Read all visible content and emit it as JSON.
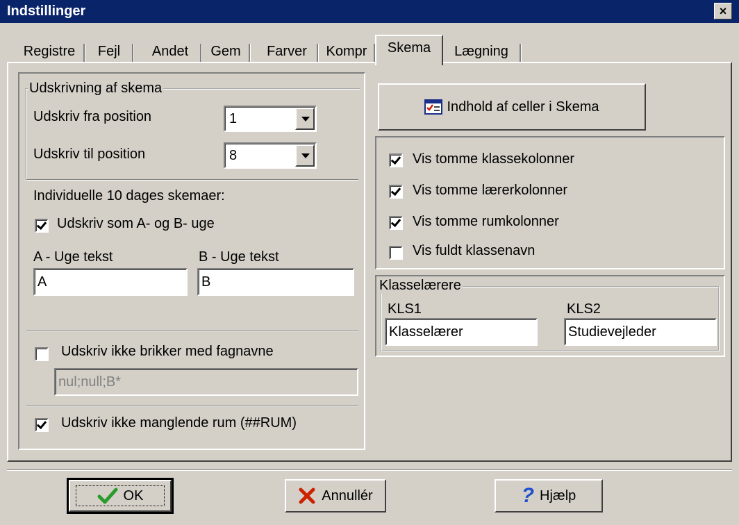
{
  "window": {
    "title": "Indstillinger",
    "close_label": "×"
  },
  "tabs": [
    {
      "label": "Registre"
    },
    {
      "label": "Fejl"
    },
    {
      "label": "Andet"
    },
    {
      "label": "Gem"
    },
    {
      "label": "Farver"
    },
    {
      "label": "Kompr"
    },
    {
      "label": "Skema",
      "active": true
    },
    {
      "label": "Lægning"
    }
  ],
  "print_group": {
    "label": "Udskrivning af skema",
    "from_label": "Udskriv fra position",
    "from_value": "1",
    "to_label": "Udskriv til position",
    "to_value": "8"
  },
  "ten_day": {
    "heading": "Individuelle 10 dages skemaer:",
    "ab_week_label": "Udskriv som A- og B- uge",
    "ab_week_checked": true,
    "a_label": "A - Uge tekst",
    "a_value": "A",
    "b_label": "B - Uge tekst",
    "b_value": "B"
  },
  "subjects": {
    "label": "Udskriv ikke brikker med fagnavne",
    "checked": false,
    "value": "nul;null;B*"
  },
  "missing_room": {
    "label": "Udskriv ikke manglende rum (##RUM)",
    "checked": true
  },
  "cells_button": {
    "label": "Indhold af celler i Skema"
  },
  "show_options": [
    {
      "label": "Vis tomme klassekolonner",
      "checked": true
    },
    {
      "label": "Vis tomme lærerkolonner",
      "checked": true
    },
    {
      "label": "Vis tomme rumkolonner",
      "checked": true
    },
    {
      "label": "Vis fuldt klassenavn",
      "checked": false
    }
  ],
  "class_teachers": {
    "label": "Klasselærere",
    "kls1_label": "KLS1",
    "kls1_value": "Klasselærer",
    "kls2_label": "KLS2",
    "kls2_value": "Studievejleder"
  },
  "buttons": {
    "ok": "OK",
    "cancel": "Annullér",
    "help": "Hjælp"
  },
  "colors": {
    "face": "#d4d0c8",
    "title": "#0a246a",
    "check_red": "#cc2200",
    "help_blue": "#1f4fd0",
    "ok_green": "#2a9a2a"
  }
}
